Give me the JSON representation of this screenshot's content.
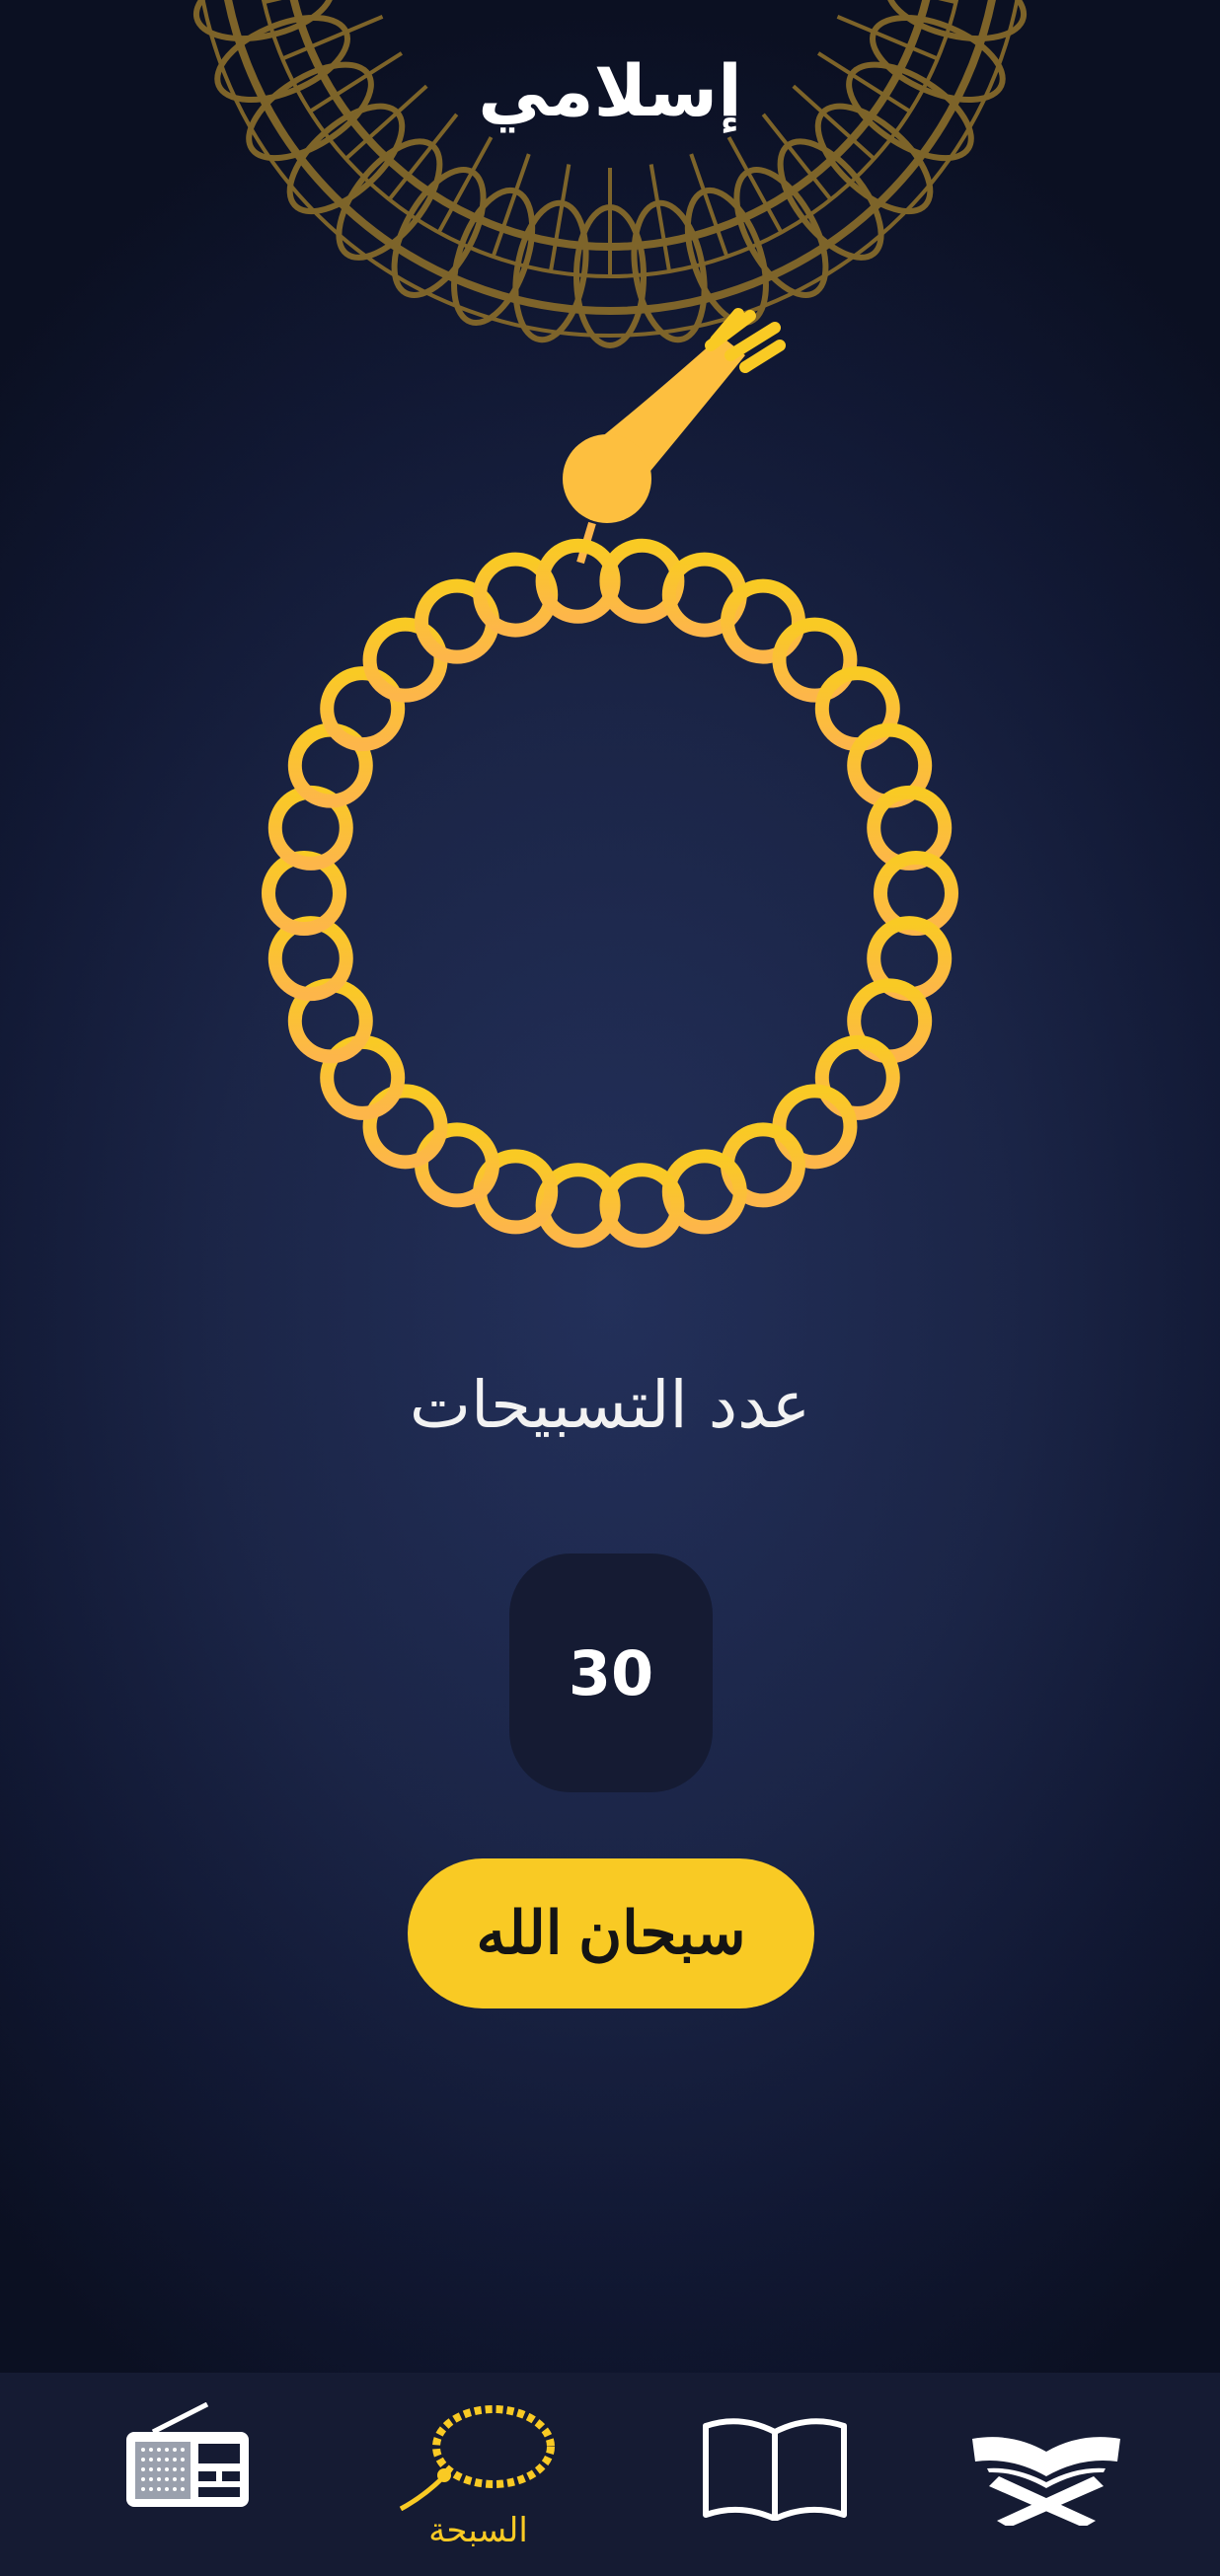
{
  "header": {
    "title": "إسلامي"
  },
  "counter": {
    "label": "عدد التسبيحات",
    "value": "30"
  },
  "action": {
    "label": "سبحان الله"
  },
  "nav": {
    "items": [
      {
        "icon": "radio-icon"
      },
      {
        "icon": "tasbeeh-icon",
        "label": "السبحة",
        "active": true
      },
      {
        "icon": "book-icon"
      },
      {
        "icon": "quran-icon"
      }
    ]
  },
  "colors": {
    "accent": "#f9ca24",
    "background": "#1b2547",
    "panel": "#151b33",
    "ornament": "#8a6d2a"
  }
}
